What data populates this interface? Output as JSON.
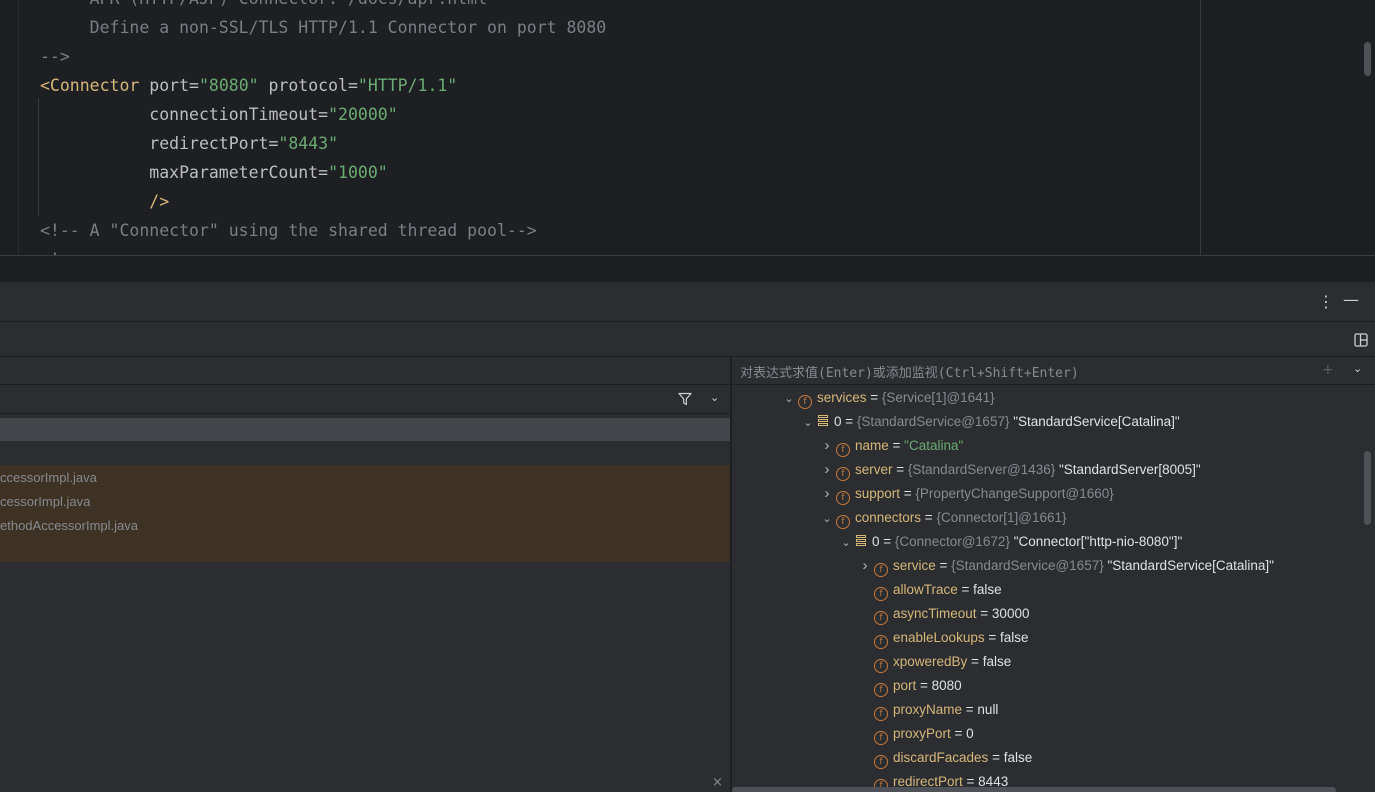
{
  "editor": {
    "lines": [
      {
        "parts": [
          {
            "t": "     APR (HTTP/AJP) Connector: /docs/apr.html",
            "c": "comment"
          }
        ]
      },
      {
        "parts": [
          {
            "t": "     Define a non-SSL/TLS HTTP/1.1 Connector on port 8080",
            "c": "comment"
          }
        ]
      },
      {
        "parts": [
          {
            "t": "-->",
            "c": "comment"
          }
        ]
      },
      {
        "parts": [
          {
            "t": "<Connector",
            "c": "tag"
          },
          {
            "t": " port",
            "c": "attr"
          },
          {
            "t": "=",
            "c": "attr"
          },
          {
            "t": "\"8080\"",
            "c": "str"
          },
          {
            "t": " protocol",
            "c": "attr"
          },
          {
            "t": "=",
            "c": "attr"
          },
          {
            "t": "\"HTTP/1.1\"",
            "c": "str"
          }
        ]
      },
      {
        "parts": [
          {
            "t": "           connectionTimeout",
            "c": "attr"
          },
          {
            "t": "=",
            "c": "attr"
          },
          {
            "t": "\"20000\"",
            "c": "str"
          }
        ]
      },
      {
        "parts": [
          {
            "t": "           redirectPort",
            "c": "attr"
          },
          {
            "t": "=",
            "c": "attr"
          },
          {
            "t": "\"8443\"",
            "c": "str"
          }
        ]
      },
      {
        "parts": [
          {
            "t": "           maxParameterCount",
            "c": "attr"
          },
          {
            "t": "=",
            "c": "attr"
          },
          {
            "t": "\"1000\"",
            "c": "str"
          }
        ]
      },
      {
        "parts": [
          {
            "t": "           />",
            "c": "tag"
          }
        ]
      },
      {
        "parts": [
          {
            "t": "<!-- A \"Connector\" using the shared thread pool-->",
            "c": "comment"
          }
        ]
      },
      {
        "parts": [
          {
            "t": "<!--",
            "c": "comment"
          }
        ]
      }
    ]
  },
  "toolbar": {
    "more_icon": "more-vertical-icon",
    "minimize_icon": "minimize-icon",
    "layout_icon": "layout-icon"
  },
  "frames": {
    "filter_icon": "filter-icon",
    "dropdown_icon": "chevron-down-icon",
    "rows": [
      "ccessorImpl.java",
      "cessorImpl.java",
      "ethodAccessorImpl.java"
    ],
    "close_icon": "close-icon"
  },
  "variables": {
    "eval_placeholder": "对表达式求值(Enter)或添加监视(Ctrl+Shift+Enter)",
    "rows": [
      {
        "depth": 0,
        "chev": "down",
        "icon": "field",
        "name": "services",
        "type": "{Service[1]@1641}",
        "str": ""
      },
      {
        "depth": 1,
        "chev": "down",
        "icon": "array",
        "name": "0",
        "type": "{StandardService@1657}",
        "str": "\"StandardService[Catalina]\""
      },
      {
        "depth": 2,
        "chev": "right",
        "icon": "field",
        "name": "name",
        "type": "",
        "str": "\"Catalina\"",
        "strcolor": "#6aab73"
      },
      {
        "depth": 2,
        "chev": "right",
        "icon": "field",
        "name": "server",
        "type": "{StandardServer@1436}",
        "str": "\"StandardServer[8005]\""
      },
      {
        "depth": 2,
        "chev": "right",
        "icon": "field",
        "name": "support",
        "type": "{PropertyChangeSupport@1660}",
        "str": ""
      },
      {
        "depth": 2,
        "chev": "down",
        "icon": "field",
        "name": "connectors",
        "type": "{Connector[1]@1661}",
        "str": ""
      },
      {
        "depth": 3,
        "chev": "down",
        "icon": "array",
        "name": "0",
        "type": "{Connector@1672}",
        "str": "\"Connector[\"http-nio-8080\"]\""
      },
      {
        "depth": 4,
        "chev": "right",
        "icon": "field",
        "name": "service",
        "type": "{StandardService@1657}",
        "str": "\"StandardService[Catalina]\""
      },
      {
        "depth": 4,
        "chev": "none",
        "icon": "field",
        "name": "allowTrace",
        "type": "",
        "str": "false"
      },
      {
        "depth": 4,
        "chev": "none",
        "icon": "field",
        "name": "asyncTimeout",
        "type": "",
        "str": "30000"
      },
      {
        "depth": 4,
        "chev": "none",
        "icon": "field",
        "name": "enableLookups",
        "type": "",
        "str": "false"
      },
      {
        "depth": 4,
        "chev": "none",
        "icon": "field",
        "name": "xpoweredBy",
        "type": "",
        "str": "false"
      },
      {
        "depth": 4,
        "chev": "none",
        "icon": "field",
        "name": "port",
        "type": "",
        "str": "8080"
      },
      {
        "depth": 4,
        "chev": "none",
        "icon": "field",
        "name": "proxyName",
        "type": "",
        "str": "null"
      },
      {
        "depth": 4,
        "chev": "none",
        "icon": "field",
        "name": "proxyPort",
        "type": "",
        "str": "0"
      },
      {
        "depth": 4,
        "chev": "none",
        "icon": "field",
        "name": "discardFacades",
        "type": "",
        "str": "false"
      },
      {
        "depth": 4,
        "chev": "none",
        "icon": "field",
        "name": "redirectPort",
        "type": "",
        "str": "8443"
      }
    ]
  }
}
